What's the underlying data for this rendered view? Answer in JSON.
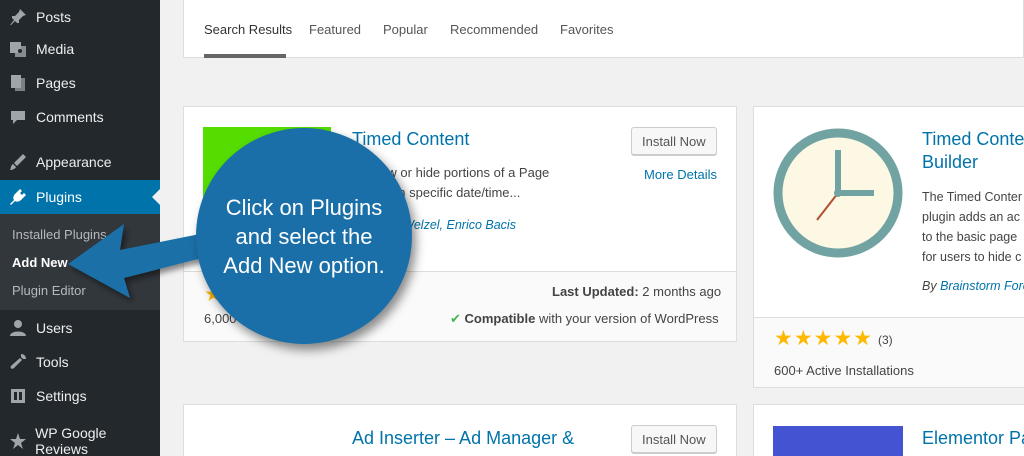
{
  "sidebar": {
    "items": [
      {
        "label": "Posts",
        "icon": "pin-icon"
      },
      {
        "label": "Media",
        "icon": "media-icon"
      },
      {
        "label": "Pages",
        "icon": "pages-icon"
      },
      {
        "label": "Comments",
        "icon": "comments-icon"
      },
      {
        "label": "Appearance",
        "icon": "appearance-icon"
      },
      {
        "label": "Plugins",
        "icon": "plugins-icon"
      },
      {
        "label": "Users",
        "icon": "users-icon"
      },
      {
        "label": "Tools",
        "icon": "tools-icon"
      },
      {
        "label": "Settings",
        "icon": "settings-icon"
      },
      {
        "label": "WP Google Reviews",
        "icon": "reviews-icon"
      }
    ],
    "submenu": [
      "Installed Plugins",
      "Add New",
      "Plugin Editor"
    ]
  },
  "tabs": [
    "Search Results",
    "Featured",
    "Popular",
    "Recommended",
    "Favorites"
  ],
  "cards": {
    "timed_content": {
      "title": "Timed Content",
      "install": "Install Now",
      "more": "More Details",
      "desc1": "to show or hide portions of a Page",
      "desc2": "based on specific date/time...",
      "authors": "gh, Arno Welzel, Enrico Bacis",
      "installs": "6,000",
      "last_updated_label": "Last Updated:",
      "last_updated_value": "2 months ago",
      "compat_strong": "Compatible",
      "compat_rest": "with your version of WordPress"
    },
    "timed_builder": {
      "title1": "Timed Conte",
      "title2": "Builder",
      "desc1": "The Timed Conter",
      "desc2": "plugin adds an ac",
      "desc3": "to the basic page",
      "desc4": "for users to hide c",
      "by": "By",
      "author": "Brainstorm Forc",
      "rating_count": "(3)",
      "installs": "600+ Active Installations",
      "stars": "★★★★★"
    },
    "ad_inserter": {
      "title": "Ad Inserter – Ad Manager &",
      "install": "Install Now"
    },
    "elementor": {
      "title": "Elementor Pa"
    }
  },
  "callout": {
    "text": "Click on Plugins and select the Add New option."
  },
  "colors": {
    "sidebar": "#23282d",
    "active": "#0073aa",
    "callout": "#1a6fa8",
    "star": "#ffb900"
  }
}
